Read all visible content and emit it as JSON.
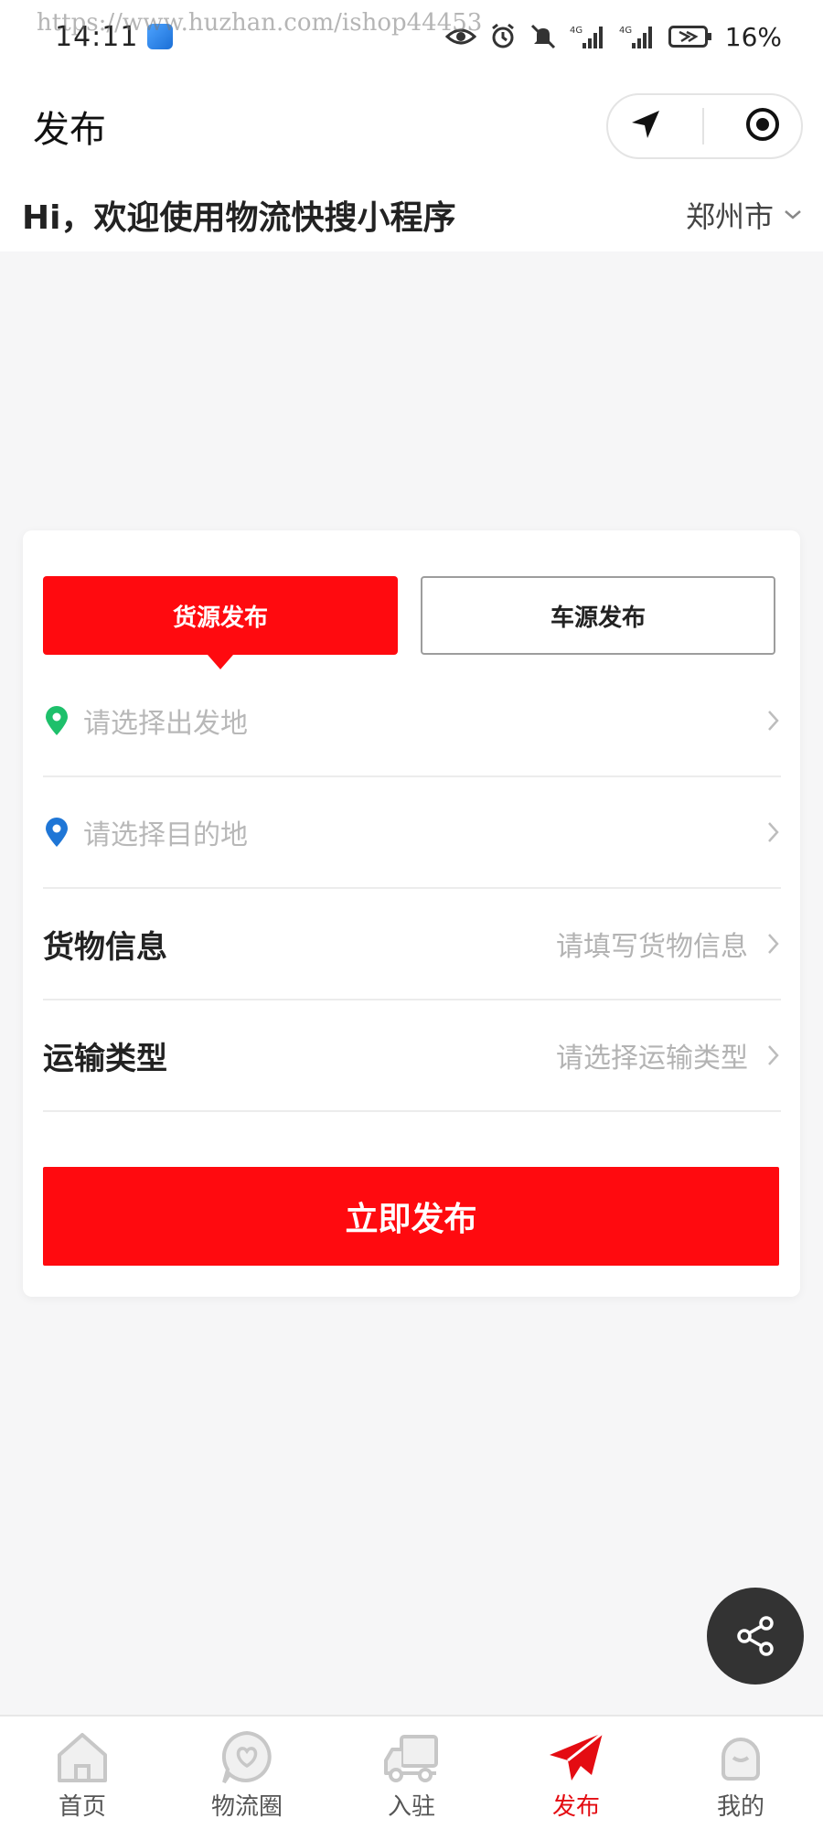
{
  "status_bar": {
    "time": "14:11",
    "watermark": "https://www.huzhan.com/ishop44453",
    "network": "4G",
    "battery": "16%",
    "icons": [
      "eye-icon",
      "alarm-icon",
      "mute-icon",
      "signal-4g-icon",
      "signal-4g-icon",
      "battery-icon"
    ]
  },
  "nav": {
    "title": "发布",
    "capsule_icons": [
      "location-arrow-icon",
      "record-circle-icon"
    ]
  },
  "greeting": {
    "text": "Hi，欢迎使用物流快搜小程序",
    "city": "郑州市"
  },
  "form": {
    "tabs": [
      {
        "label": "货源发布",
        "active": true
      },
      {
        "label": "车源发布",
        "active": false
      }
    ],
    "origin_placeholder": "请选择出发地",
    "destination_placeholder": "请选择目的地",
    "goods_label": "货物信息",
    "goods_placeholder": "请填写货物信息",
    "transport_label": "运输类型",
    "transport_placeholder": "请选择运输类型",
    "submit_label": "立即发布"
  },
  "tab_bar": {
    "items": [
      {
        "label": "首页",
        "icon": "home-icon"
      },
      {
        "label": "物流圈",
        "icon": "heart-chat-icon"
      },
      {
        "label": "入驻",
        "icon": "truck-icon"
      },
      {
        "label": "发布",
        "icon": "paper-plane-icon",
        "active": true
      },
      {
        "label": "我的",
        "icon": "profile-icon"
      }
    ]
  },
  "colors": {
    "accent": "#ff0a0f",
    "origin_pin": "#1ec06b",
    "destination_pin": "#1f76d6",
    "share_button": "#333333"
  }
}
